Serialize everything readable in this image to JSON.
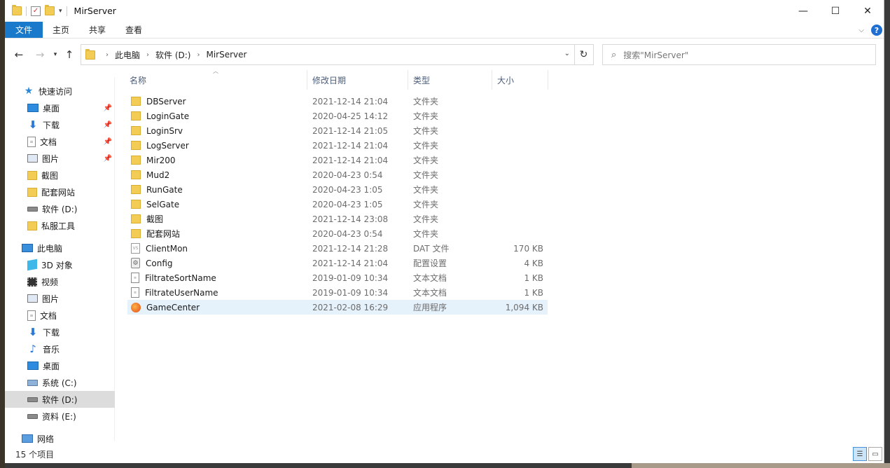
{
  "window": {
    "title": "MirServer",
    "controls": {
      "minimize": "—",
      "maximize": "☐",
      "close": "✕"
    }
  },
  "ribbon": {
    "tabs": [
      "文件",
      "主页",
      "共享",
      "查看"
    ],
    "help": "?"
  },
  "address": {
    "crumbs": [
      "此电脑",
      "软件 (D:)",
      "MirServer"
    ],
    "search_placeholder": "搜索\"MirServer\""
  },
  "sidebar": {
    "quick_access": "快速访问",
    "quick_items": [
      {
        "label": "桌面",
        "icon": "desktop-icon",
        "pinned": true
      },
      {
        "label": "下载",
        "icon": "download-icon",
        "pinned": true
      },
      {
        "label": "文档",
        "icon": "document-icon",
        "pinned": true
      },
      {
        "label": "图片",
        "icon": "picture-icon",
        "pinned": true
      },
      {
        "label": "截图",
        "icon": "folder-icon",
        "pinned": false
      },
      {
        "label": "配套网站",
        "icon": "folder-icon",
        "pinned": false
      },
      {
        "label": "软件 (D:)",
        "icon": "drive-icon",
        "pinned": false
      },
      {
        "label": "私服工具",
        "icon": "folder-icon",
        "pinned": false
      }
    ],
    "this_pc": "此电脑",
    "pc_items": [
      {
        "label": "3D 对象",
        "icon": "3d-objects-icon"
      },
      {
        "label": "视频",
        "icon": "video-icon"
      },
      {
        "label": "图片",
        "icon": "picture-icon"
      },
      {
        "label": "文档",
        "icon": "document-icon"
      },
      {
        "label": "下载",
        "icon": "download-icon"
      },
      {
        "label": "音乐",
        "icon": "music-icon"
      },
      {
        "label": "桌面",
        "icon": "desktop-icon"
      },
      {
        "label": "系统 (C:)",
        "icon": "system-drive-icon"
      },
      {
        "label": "软件 (D:)",
        "icon": "drive-icon",
        "selected": true
      },
      {
        "label": "资料 (E:)",
        "icon": "drive-icon"
      }
    ],
    "network": "网络"
  },
  "columns": {
    "name": "名称",
    "date": "修改日期",
    "type": "类型",
    "size": "大小"
  },
  "files": [
    {
      "name": "DBServer",
      "date": "2021-12-14 21:04",
      "type": "文件夹",
      "size": "",
      "icon": "folder"
    },
    {
      "name": "LoginGate",
      "date": "2020-04-25 14:12",
      "type": "文件夹",
      "size": "",
      "icon": "folder"
    },
    {
      "name": "LoginSrv",
      "date": "2021-12-14 21:05",
      "type": "文件夹",
      "size": "",
      "icon": "folder"
    },
    {
      "name": "LogServer",
      "date": "2021-12-14 21:04",
      "type": "文件夹",
      "size": "",
      "icon": "folder"
    },
    {
      "name": "Mir200",
      "date": "2021-12-14 21:04",
      "type": "文件夹",
      "size": "",
      "icon": "folder"
    },
    {
      "name": "Mud2",
      "date": "2020-04-23 0:54",
      "type": "文件夹",
      "size": "",
      "icon": "folder"
    },
    {
      "name": "RunGate",
      "date": "2020-04-23 1:05",
      "type": "文件夹",
      "size": "",
      "icon": "folder"
    },
    {
      "name": "SelGate",
      "date": "2020-04-23 1:05",
      "type": "文件夹",
      "size": "",
      "icon": "folder"
    },
    {
      "name": "截图",
      "date": "2021-12-14 23:08",
      "type": "文件夹",
      "size": "",
      "icon": "folder"
    },
    {
      "name": "配套网站",
      "date": "2020-04-23 0:54",
      "type": "文件夹",
      "size": "",
      "icon": "folder"
    },
    {
      "name": "ClientMon",
      "date": "2021-12-14 21:28",
      "type": "DAT 文件",
      "size": "170 KB",
      "icon": "dat"
    },
    {
      "name": "Config",
      "date": "2021-12-14 21:04",
      "type": "配置设置",
      "size": "4 KB",
      "icon": "cfg"
    },
    {
      "name": "FiltrateSortName",
      "date": "2019-01-09 10:34",
      "type": "文本文档",
      "size": "1 KB",
      "icon": "txt"
    },
    {
      "name": "FiltrateUserName",
      "date": "2019-01-09 10:34",
      "type": "文本文档",
      "size": "1 KB",
      "icon": "txt"
    },
    {
      "name": "GameCenter",
      "date": "2021-02-08 16:29",
      "type": "应用程序",
      "size": "1,094 KB",
      "icon": "app",
      "selected": true
    }
  ],
  "status": {
    "count": "15 个项目"
  }
}
